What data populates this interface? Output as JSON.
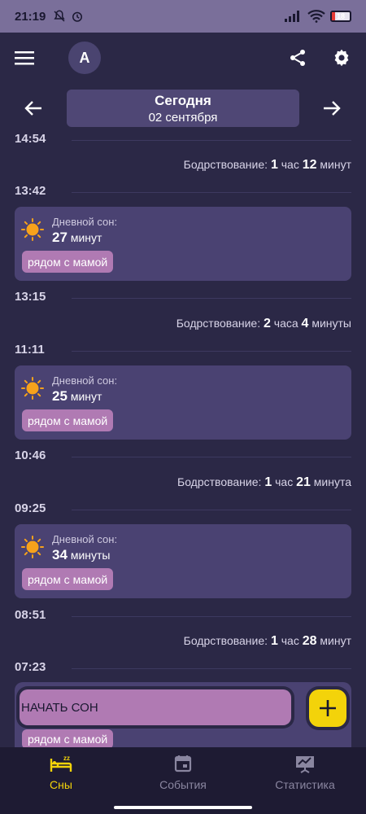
{
  "status": {
    "time": "21:19",
    "battery": "18",
    "battery_level": 0.18
  },
  "app": {
    "avatar_letter": "A"
  },
  "date_nav": {
    "title": "Сегодня",
    "date": "02 сентября"
  },
  "timeline": {
    "times": [
      "14:54",
      "13:42",
      "13:15",
      "11:11",
      "10:46",
      "09:25",
      "08:51",
      "07:23"
    ],
    "wake_label": "Бодрствование:",
    "wake": [
      {
        "v1": "1",
        "u1": "час",
        "v2": "12",
        "u2": "минут"
      },
      {
        "v1": "2",
        "u1": "часа",
        "v2": "4",
        "u2": "минуты"
      },
      {
        "v1": "1",
        "u1": "час",
        "v2": "21",
        "u2": "минута"
      },
      {
        "v1": "1",
        "u1": "час",
        "v2": "28",
        "u2": "минут"
      }
    ],
    "sleep_label": "Дневной сон:",
    "sleeps": [
      {
        "value": "27",
        "unit": "минут",
        "tag": "рядом с мамой"
      },
      {
        "value": "25",
        "unit": "минут",
        "tag": "рядом с мамой"
      },
      {
        "value": "34",
        "unit": "минуты",
        "tag": "рядом с мамой"
      }
    ],
    "last_tag": "рядом с мамой"
  },
  "actions": {
    "start_sleep": "НАЧАТЬ СОН",
    "fab": "+"
  },
  "bottom_nav": {
    "items": [
      {
        "label": "Сны"
      },
      {
        "label": "События"
      },
      {
        "label": "Статистика"
      }
    ]
  },
  "colors": {
    "background": "#2b2846",
    "card": "#4a4272",
    "accent_yellow": "#f3d30a",
    "tag": "#b07ab3"
  }
}
